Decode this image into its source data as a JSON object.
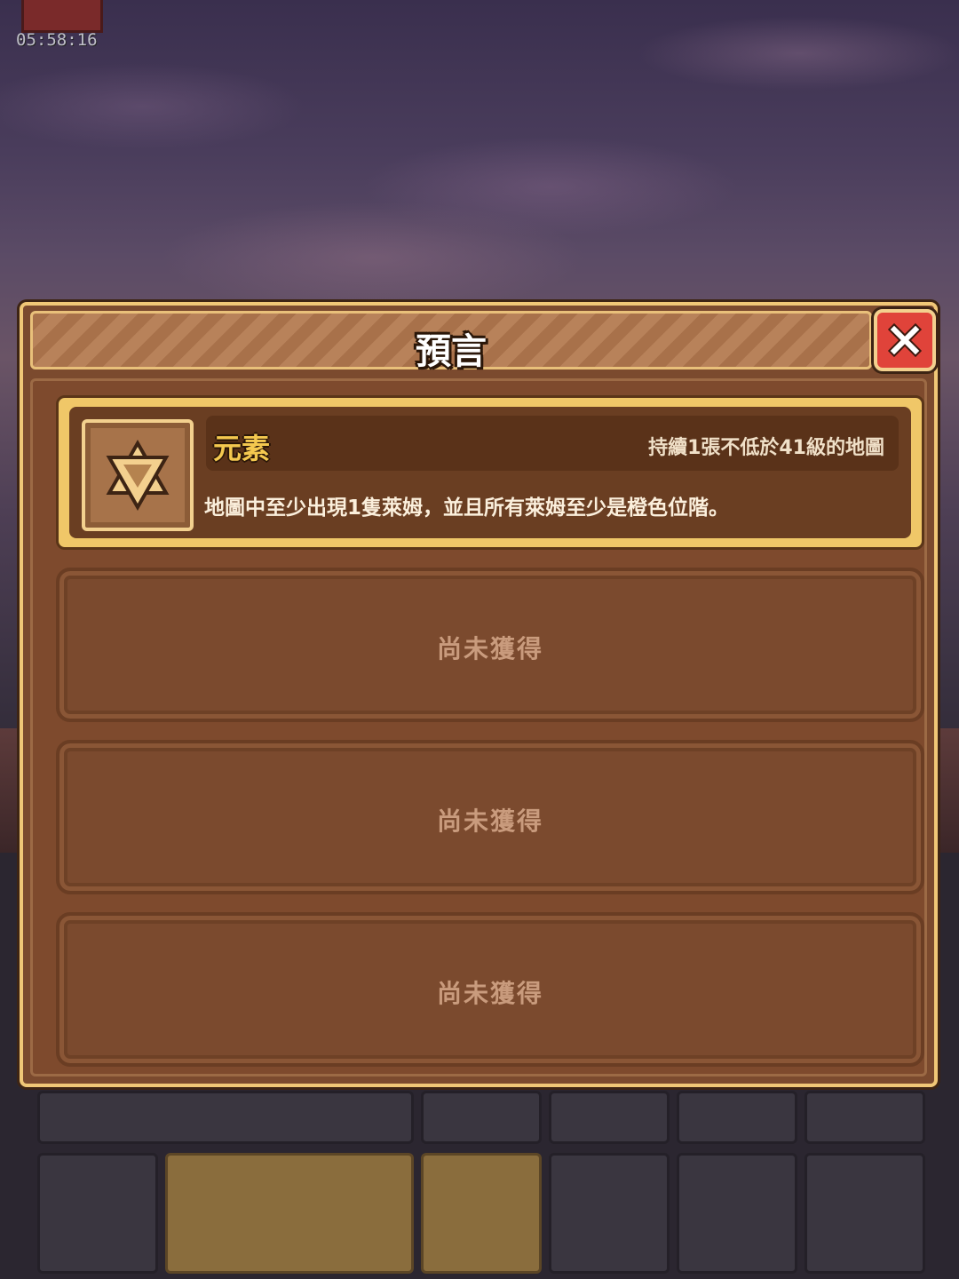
{
  "timer": "05:58:16",
  "dialog": {
    "title": "預言",
    "close_icon": "close-x-icon"
  },
  "prophecies": [
    {
      "name": "元素",
      "condition": "持續1張不低於41級的地圖",
      "description": "地圖中至少出現1隻萊姆，並且所有萊姆至少是橙色位階。",
      "icon": "hexagram-icon"
    }
  ],
  "locked_slots": [
    {
      "label": "尚未獲得"
    },
    {
      "label": "尚未獲得"
    },
    {
      "label": "尚未獲得"
    }
  ],
  "colors": {
    "panel": "#7b4a2e",
    "gold_border": "#f0c768",
    "close_button": "#e0433a",
    "name_text": "#f4c84f"
  }
}
